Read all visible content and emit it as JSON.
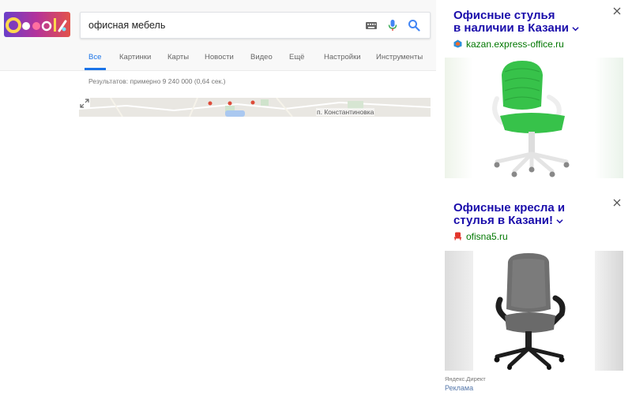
{
  "search": {
    "query": "офисная мебель",
    "logo": "Google"
  },
  "tabs": [
    {
      "label": "Все",
      "active": true
    },
    {
      "label": "Картинки",
      "active": false
    },
    {
      "label": "Карты",
      "active": false
    },
    {
      "label": "Новости",
      "active": false
    },
    {
      "label": "Видео",
      "active": false
    },
    {
      "label": "Ещё",
      "active": false
    },
    {
      "label": "Настройки",
      "active": false
    },
    {
      "label": "Инструменты",
      "active": false
    }
  ],
  "results_stats": "Результатов: примерно 9 240 000 (0,64 сек.)",
  "map": {
    "place_label": "п. Константиновка"
  },
  "ads": [
    {
      "title_line1": "Офисные стулья",
      "title_line2": "в наличии в Казани",
      "domain": "kazan.express-office.ru",
      "image": "green-office-chair"
    },
    {
      "title_line1": "Офисные кресла и",
      "title_line2": "стулья в Казани!",
      "domain": "ofisna5.ru",
      "image": "grey-executive-chair"
    }
  ],
  "yandex_direct": {
    "label": "Яндекс.Директ",
    "ads_link": "Реклама"
  },
  "colors": {
    "link_blue": "#1a0dab",
    "url_green": "#007700",
    "accent_blue": "#1a73e8",
    "chair_green": "#37c24a"
  }
}
